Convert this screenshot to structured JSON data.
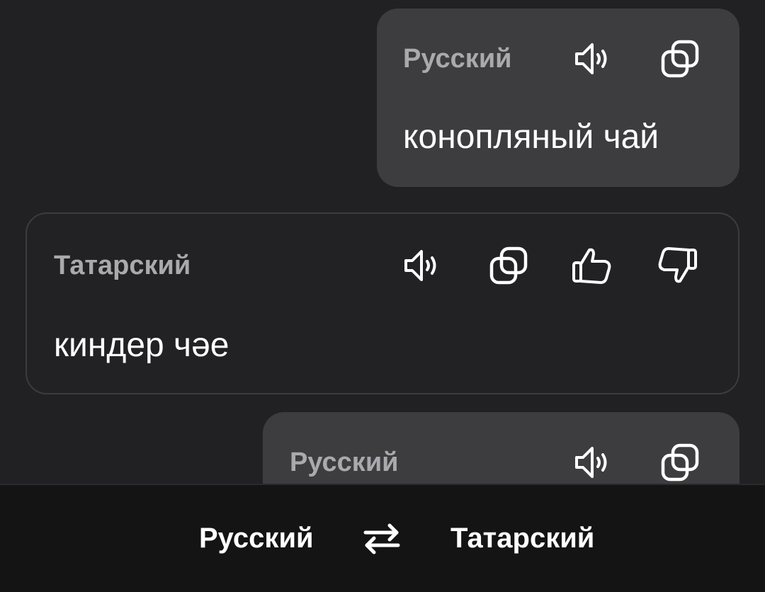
{
  "conversation": {
    "messages": [
      {
        "role": "source",
        "language": "Русский",
        "text": "конопляный чай"
      },
      {
        "role": "translation",
        "language": "Татарский",
        "text": "киндер чәе"
      },
      {
        "role": "source",
        "language": "Русский",
        "text": ""
      }
    ]
  },
  "icons": {
    "speak": "speaker-icon",
    "copy": "copy-icon",
    "like": "thumbs-up-icon",
    "dislike": "thumbs-down-icon",
    "swap": "swap-arrows-icon"
  },
  "language_bar": {
    "source_language": "Русский",
    "target_language": "Татарский"
  },
  "colors": {
    "background": "#212123",
    "source_card": "#3d3d40",
    "target_card_border": "#3c3c3f",
    "label": "#a9a9ae",
    "bottom_bar": "#141414"
  }
}
